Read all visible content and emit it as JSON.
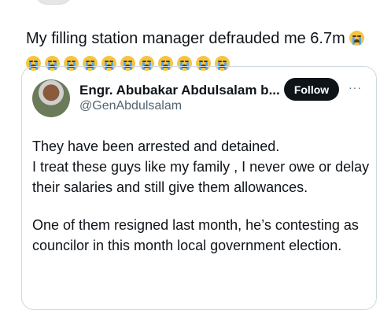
{
  "post": {
    "text": "My filling station manager defrauded me 6.7m",
    "emoji_count": 11
  },
  "quote": {
    "author_name": "Engr. Abubakar Abdulsalam b...",
    "author_handle": "@GenAbdulsalam",
    "follow_label": "Follow",
    "more_label": "···",
    "paragraph_1": "They have been arrested and detained.\nI treat these guys like my family , I never owe or delay their salaries and still give them allowances.",
    "paragraph_2": "One of them resigned last month, he’s contesting as councilor in this month local government election."
  }
}
